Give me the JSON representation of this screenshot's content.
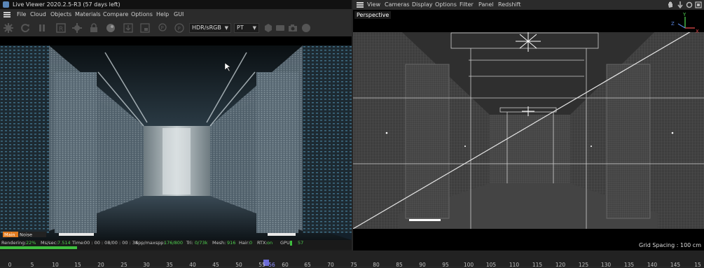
{
  "live_viewer": {
    "title": "Live Viewer 2020.2.5-R3 (57 days left)",
    "menu": [
      "File",
      "Cloud",
      "Objects",
      "Materials",
      "Compare",
      "Options",
      "Help",
      "GUI"
    ],
    "toolbar_icons": [
      "render-icon",
      "refresh-icon",
      "pause-icon",
      "region-render-icon",
      "settings-gear-icon",
      "lock-icon",
      "material-sphere-icon",
      "snapshot-down-icon",
      "save-icon",
      "pin-icon",
      "display-p-icon"
    ],
    "color_select": "HDR/sRGB",
    "mode_select": "PT",
    "status": {
      "rendering_label": "Rendering:",
      "rendering_value": "22%",
      "ms_label": "Ms/sec:",
      "ms_value": "7.514",
      "time_label": "Time:",
      "time_value": "00 : 00 : 08/00 : 00 : 34",
      "spp_label": "Spp/maxspp:",
      "spp_value": "176/800",
      "tri_label": "Tri:",
      "tri_value": "0/73k",
      "mesh_label": "Mesh:",
      "mesh_value": "916",
      "hair_label": "Hair:",
      "hair_value": "0",
      "rtx_label": "RTX:",
      "rtx_value": "on",
      "gpu_label": "GPU:",
      "gpu_value": "57"
    },
    "progress": 0.22,
    "bottom_tags": [
      "Main",
      "Noise"
    ]
  },
  "viewport": {
    "menu": [
      "View",
      "Cameras",
      "Display",
      "Options",
      "Filter",
      "Panel",
      "Redshift"
    ],
    "camera_label": "Perspective",
    "grid_spacing": "Grid Spacing : 100 cm",
    "axis_labels": [
      "Y",
      "Z",
      "X"
    ]
  },
  "timeline": {
    "ticks": [
      "0",
      "5",
      "10",
      "15",
      "20",
      "25",
      "30",
      "35",
      "40",
      "45",
      "50",
      "55",
      "56",
      "60",
      "65",
      "70",
      "75",
      "80",
      "85",
      "90",
      "95",
      "100",
      "105",
      "110",
      "115",
      "120",
      "125",
      "130",
      "135",
      "140",
      "145",
      "15"
    ],
    "current_frame": "56"
  },
  "colors": {
    "accent_green": "#3fbf3f",
    "status_green": "#4fd14f",
    "marker": "#6b6bd8",
    "tag_orange": "#e07a1e"
  }
}
